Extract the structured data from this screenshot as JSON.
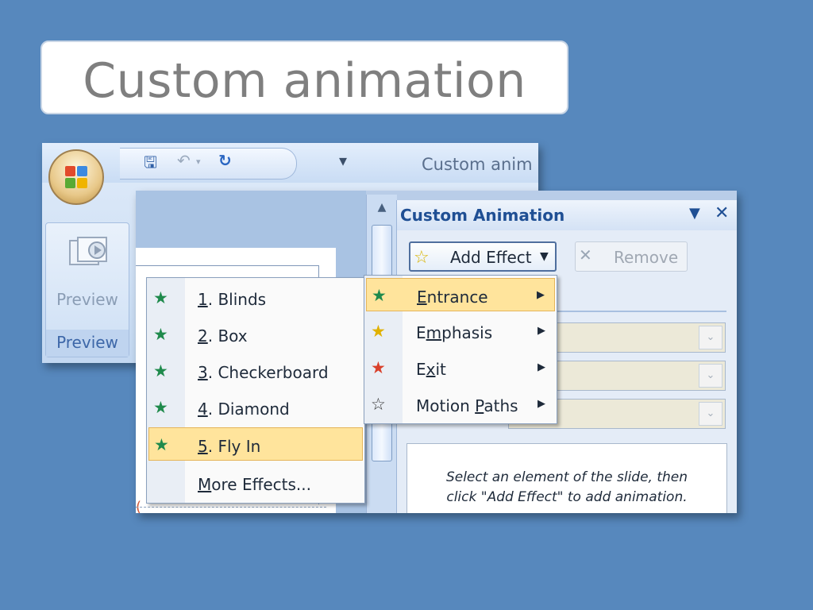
{
  "slide_title": "Custom animation",
  "app": {
    "title": "Custom anim",
    "qat": {
      "more": "▾"
    },
    "ribbon": {
      "preview_button": "Preview",
      "preview_group": "Preview"
    }
  },
  "task_pane": {
    "title": "Custom Animation",
    "dropdown": "▼",
    "close": "✕",
    "add_effect": "Add Effect",
    "add_effect_caret": "▼",
    "remove": "Remove",
    "combo_arrow": "⌄",
    "hint_line1": "Select an element of the slide, then",
    "hint_line2": "click \"Add Effect\" to add animation."
  },
  "add_effect_menu": [
    {
      "pre": "",
      "accel": "E",
      "post": "ntrance",
      "icon": "entrance-star-icon",
      "color": "#1f8a4c"
    },
    {
      "pre": "E",
      "accel": "m",
      "post": "phasis",
      "icon": "emphasis-star-icon",
      "color": "#e0b100"
    },
    {
      "pre": "E",
      "accel": "x",
      "post": "it",
      "icon": "exit-star-icon",
      "color": "#d9402b"
    },
    {
      "pre": "Motion ",
      "accel": "P",
      "post": "aths",
      "icon": "motion-path-star-icon",
      "color": "#ffffff"
    }
  ],
  "entrance_menu": [
    {
      "accel": "1",
      "rest": ". Blinds"
    },
    {
      "accel": "2",
      "rest": ". Box"
    },
    {
      "accel": "3",
      "rest": ". Checkerboard"
    },
    {
      "accel": "4",
      "rest": ". Diamond"
    },
    {
      "accel": "5",
      "rest": ". Fly In"
    },
    {
      "accel": "M",
      "rest": "ore Effects..."
    }
  ],
  "colors": {
    "background": "#5788bd",
    "highlight": "#ffe49c",
    "pane_title": "#1f4f94"
  }
}
